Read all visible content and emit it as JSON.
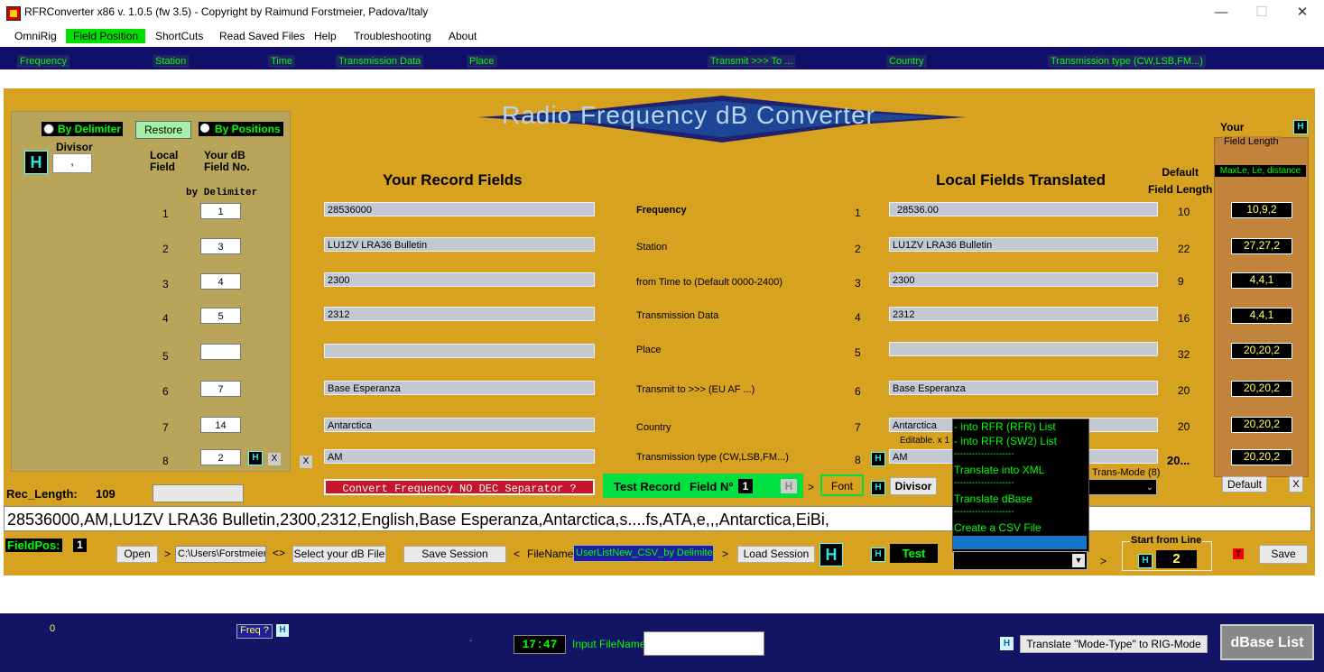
{
  "window": {
    "title": "RFRConverter x86 v. 1.0.5 (fw 3.5) - Copyright by Raimund Forstmeier, Padova/Italy",
    "minimize": "—",
    "maximize": "☐",
    "close": "✕"
  },
  "menu": [
    "OmniRig",
    "Field Position",
    "ShortCuts",
    "Read Saved Files",
    "Help",
    "Troubleshooting",
    "About"
  ],
  "header_columns": [
    "Frequency",
    "Station",
    "Time",
    "Transmission Data",
    "Place",
    "Transmit >>> To ...",
    "Country",
    "Transmission type (CW,LSB,FM...)"
  ],
  "logo": "Radio  Frequency  dB Converter",
  "left_panel": {
    "by_delimiter": "By Delimiter",
    "restore": "Restore",
    "by_positions": "By Positions",
    "divisor_label": "Divisor",
    "divisor_value": ",",
    "h": "H",
    "local_field": "Local\nField",
    "your_db_field": "Your dB\nField No.",
    "by_delimiter_sub": "by Delimiter",
    "rows": [
      {
        "n": "1",
        "v": "1"
      },
      {
        "n": "2",
        "v": "3"
      },
      {
        "n": "3",
        "v": "4"
      },
      {
        "n": "4",
        "v": "5"
      },
      {
        "n": "5",
        "v": ""
      },
      {
        "n": "6",
        "v": "7"
      },
      {
        "n": "7",
        "v": "14"
      },
      {
        "n": "8",
        "v": "2"
      }
    ],
    "x": "X"
  },
  "your_record_fields_title": "Your Record Fields",
  "local_fields_title": "Local Fields Translated",
  "default_field_length": "Default\nField Length",
  "your_field_length": {
    "your": "Your",
    "h": "H",
    "field_length": "Field Length",
    "maxle": "MaxLe, Le, distance"
  },
  "record_fields": [
    "28536000",
    "LU1ZV LRA36 Bulletin",
    "2300",
    "2312",
    "",
    "Base Esperanza",
    "Antarctica",
    "AM"
  ],
  "field_names": [
    "Frequency",
    "Station",
    "from Time to (Default 0000-2400)",
    "Transmission Data",
    "Place",
    "Transmit to >>> (EU AF ...)",
    "Country",
    "Transmission type (CW,LSB,FM...)"
  ],
  "field_numbers": [
    "1",
    "2",
    "3",
    "4",
    "5",
    "6",
    "7",
    "8"
  ],
  "translated_fields": [
    "28536.00",
    "LU1ZV LRA36 Bulletin",
    "2300",
    "2312",
    "",
    "Base Esperanza",
    "Antarctica",
    "AM"
  ],
  "default_lengths": [
    "10",
    "22",
    "9",
    "16",
    "32",
    "20",
    "20",
    "20..."
  ],
  "max_lengths": [
    "10,9,2",
    "27,27,2",
    "4,4,1",
    "4,4,1",
    "20,20,2",
    "20,20,2",
    "20,20,2",
    "20,20,2"
  ],
  "editable_note": "Editable. x 1",
  "trans_mode": "Trans-Mode (8)",
  "default_btn": "Default",
  "rec_length_label": "Rec_Length:",
  "rec_length_value": "109",
  "convert_warning": "Convert Frequency NO DEC Separator ?",
  "test_record": "Test Record",
  "field_n": "Field N°",
  "field_n_value": "1",
  "font": "Font",
  "divisor_btn": "Divisor",
  "record_line": "28536000,AM,LU1ZV LRA36 Bulletin,2300,2312,English,Base Esperanza,Antarctica,s....fs,ATA,e,,,Antarctica,EiBi,",
  "dropdown": [
    "- into RFR (RFR) List",
    "- into RFR (SW2) List",
    "--------------------",
    "Translate into XML",
    "--------------------",
    "Translate dBase",
    "--------------------",
    "Create a CSV File"
  ],
  "bottom_row": {
    "fieldpos": "FieldPos:",
    "fieldpos_value": "1",
    "open": "Open",
    "path": "C:\\Users\\Forstmeier",
    "select_db": "Select your dB File",
    "save_session": "Save Session",
    "filename_label": "FileName",
    "filename_value": "UserListNew_CSV_by Delimiter",
    "load_session": "Load Session",
    "h": "H",
    "test": "Test",
    "start_from_line": "Start from Line",
    "start_value": "2",
    "save": "Save",
    "t": "T"
  },
  "status": {
    "zero": "0",
    "freq": "Freq ?",
    "h": "H",
    "dash": "-",
    "clock": "17:47",
    "input_filename": "Input FileName",
    "translate_btn": "Translate \"Mode-Type\" to RIG-Mode",
    "dbase_list": "dBase List"
  }
}
